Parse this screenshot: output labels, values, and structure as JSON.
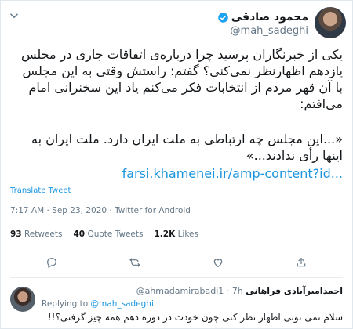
{
  "tweet": {
    "author_name": "محمود صادقی",
    "author_handle": "@mah_sadeghi",
    "text_lines": [
      "یکی از خبرنگاران پرسید چرا درباره‌ی اتفاقات جاری در مجلس",
      "یازدهم اظهارنظر نمی‌کنی؟ گفتم: راستش وقتی به این مجلس",
      "با آن قهر مردم از انتخابات فکر می‌کنم یاد این سخنرانی امام",
      "می‌افتم:"
    ],
    "quote_lines": [
      "«...این مجلس چه ارتباطی به ملت ایران دارد. ملت ایران به",
      "اینها رأی ندادند...»"
    ],
    "link": "farsi.khamenei.ir/amp-content?id...",
    "translate_label": "Translate Tweet",
    "timestamp": "7:17 AM · Sep 23, 2020 · Twitter for Android",
    "stats": {
      "retweets_count": "93",
      "retweets_label": "Retweets",
      "quotes_count": "40",
      "quotes_label": "Quote Tweets",
      "likes_count": "1.2K",
      "likes_label": "Likes"
    }
  },
  "reply": {
    "author_name": "احمدامیرآبادی فراهانی",
    "author_handle": "@ahmadamirabadi1",
    "time": "7h",
    "replying_prefix": "Replying to",
    "replying_to": "@mah_sadeghi",
    "text": "سلام نمی تونی اظهار نظر کنی چون خودت در دوره دهم همه چیز گرفتی؟!!"
  },
  "colors": {
    "link": "#1b95e0",
    "secondary_text": "#657786",
    "primary_text": "#14171a"
  }
}
